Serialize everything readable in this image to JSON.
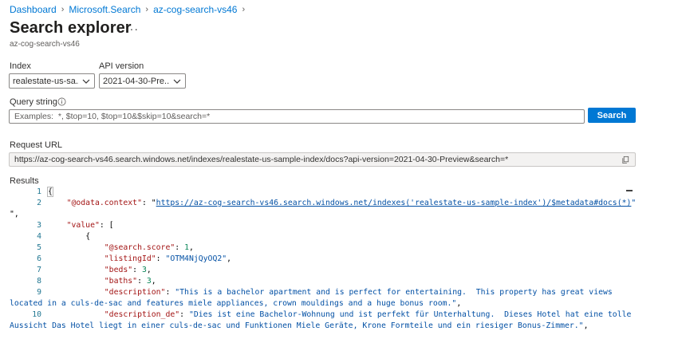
{
  "breadcrumb": [
    {
      "label": "Dashboard"
    },
    {
      "label": "Microsoft.Search"
    },
    {
      "label": "az-cog-search-vs46"
    }
  ],
  "title": "Search explorer",
  "more_label": "···",
  "subtitle": "az-cog-search-vs46",
  "index": {
    "label": "Index",
    "value": "realestate-us-sa..."
  },
  "api_version": {
    "label": "API version",
    "value": "2021-04-30-Pre..."
  },
  "query": {
    "label": "Query string",
    "placeholder": "Examples:  *, $top=10, $top=10&$skip=10&search=*",
    "value": ""
  },
  "search_button": "Search",
  "request_url": {
    "label": "Request URL",
    "value": "https://az-cog-search-vs46.search.windows.net/indexes/realestate-us-sample-index/docs?api-version=2021-04-30-Preview&search=*"
  },
  "results": {
    "label": "Results",
    "line_numbers": [
      "1",
      "2",
      "",
      "3",
      "4",
      "5",
      "6",
      "7",
      "8",
      "9",
      "",
      "10",
      ""
    ],
    "lines": {
      "l1": "{",
      "l2_key": "\"@odata.context\"",
      "l2_sep": ": \"",
      "l2_link": "https://az-cog-search-vs46.search.windows.net/indexes('realestate-us-sample-index')/$metadata#docs(*)",
      "l2_end": "\"",
      "l2_wrap": "\",",
      "l3_key": "\"value\"",
      "l3_rest": ": [",
      "l4": "{",
      "l5_key": "\"@search.score\"",
      "l5_sep": ": ",
      "l5_val": "1",
      "l5_end": ",",
      "l6_key": "\"listingId\"",
      "l6_sep": ": ",
      "l6_val": "\"OTM4NjQyOQ2\"",
      "l6_end": ",",
      "l7_key": "\"beds\"",
      "l7_sep": ": ",
      "l7_val": "3",
      "l7_end": ",",
      "l8_key": "\"baths\"",
      "l8_sep": ": ",
      "l8_val": "3",
      "l8_end": ",",
      "l9_key": "\"description\"",
      "l9_sep": ": ",
      "l9_val": "\"This is a bachelor apartment and is perfect for entertaining.  This property has great views",
      "l9_wrap": "located in a culs-de-sac and features miele appliances, crown mouldings and a huge bonus room.\"",
      "l9_end": ",",
      "l10_key": "\"description_de\"",
      "l10_sep": ": ",
      "l10_val": "\"Dies ist eine Bachelor-Wohnung und ist perfekt für Unterhaltung.  Dieses Hotel hat eine tolle",
      "l10_wrap": "Aussicht Das Hotel liegt in einer culs-de-sac und Funktionen Miele Geräte, Krone Formteile und ein riesiger Bonus-Zimmer.\"",
      "l10_end": ","
    }
  },
  "colors": {
    "accent": "#0078d4",
    "json_key": "#a31515",
    "json_string": "#0451a5",
    "json_number": "#098658",
    "line_number": "#237893"
  },
  "icons": {
    "info": "info-icon",
    "copy": "copy-icon",
    "chevron": "chevron-down-icon",
    "breadcrumb_sep": "chevron-right-icon"
  }
}
